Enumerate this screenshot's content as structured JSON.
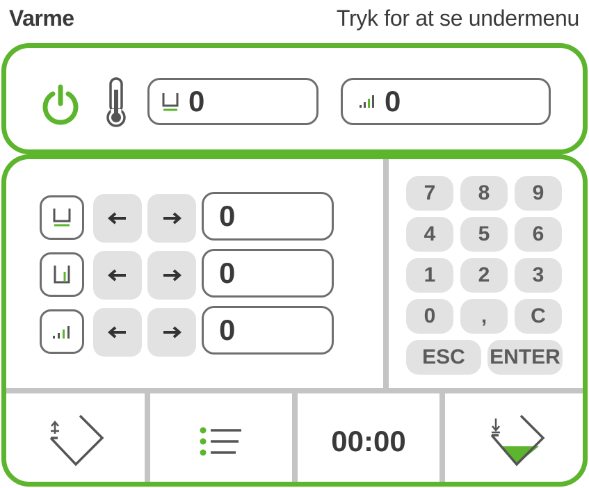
{
  "header": {
    "title": "Varme",
    "hint": "Tryk for at se undermenu"
  },
  "status_bar": {
    "power_icon": "power-icon",
    "thermometer_icon": "thermometer-icon",
    "level_value": "0",
    "signal_value": "0"
  },
  "settings": {
    "rows": [
      {
        "mode_icon": "level-icon",
        "left_label": "←",
        "right_label": "→",
        "value": "0"
      },
      {
        "mode_icon": "fill-level-icon",
        "left_label": "←",
        "right_label": "→",
        "value": "0"
      },
      {
        "mode_icon": "signal-icon",
        "left_label": "←",
        "right_label": "→",
        "value": "0"
      }
    ]
  },
  "keypad": {
    "keys": [
      "7",
      "8",
      "9",
      "4",
      "5",
      "6",
      "1",
      "2",
      "3",
      "0",
      ",",
      "C"
    ],
    "esc": "ESC",
    "enter": "ENTER"
  },
  "bottom": {
    "timer": "00:00",
    "icons": [
      "tilt-up-icon",
      "list-icon",
      "timer",
      "tilt-down-fill-icon"
    ]
  },
  "colors": {
    "accent": "#5cb52d",
    "border": "#6e6e6e",
    "key_bg": "#e2e2e2",
    "divider": "#c4c4c4"
  }
}
